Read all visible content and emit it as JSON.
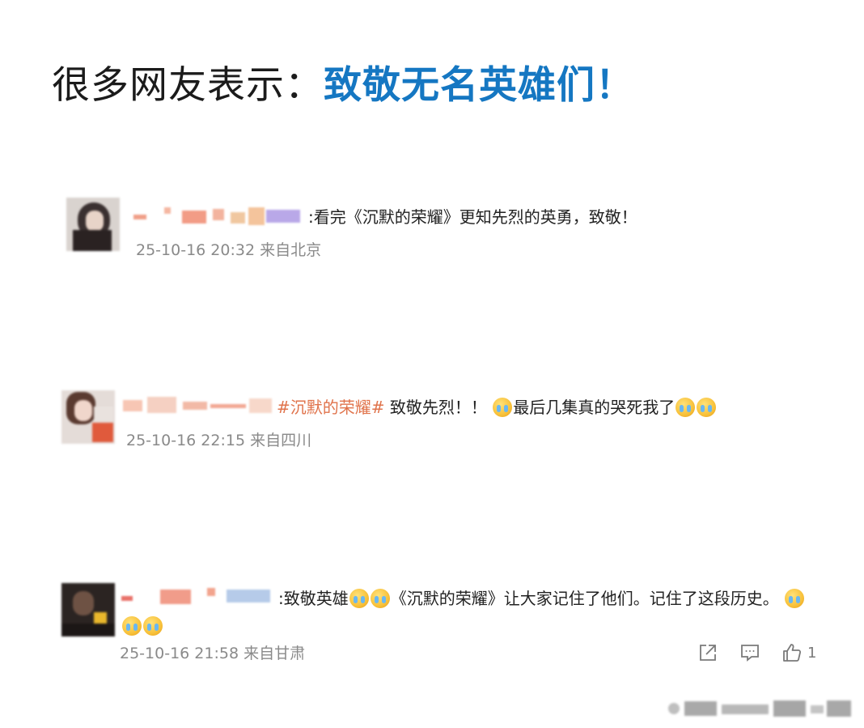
{
  "headline": {
    "prefix": "很多网友表示：",
    "emphasis": "致敬无名英雄们！"
  },
  "colors": {
    "accent": "#1577c2",
    "hashtag": "#e0734b",
    "meta": "#8a8a8a"
  },
  "comments": [
    {
      "text": ":看完《沉默的荣耀》更知先烈的英勇，致敬！",
      "timestamp": "25-10-16 20:32",
      "location": "来自北京"
    },
    {
      "hashtag": "#沉默的荣耀#",
      "text_part1": " 致敬先烈！！",
      "text_part2": "最后几集真的哭死我了",
      "timestamp": "25-10-16 22:15",
      "location": "来自四川"
    },
    {
      "text_part1": ":致敬英雄",
      "text_part2": "《沉默的荣耀》让大家记住了他们。记住了这段历史。",
      "timestamp": "25-10-16 21:58",
      "location": "来自甘肃"
    }
  ],
  "actions": {
    "share_icon": "share-icon",
    "comment_icon": "comment-icon",
    "like_icon": "thumbs-up-icon",
    "like_count": "1"
  }
}
